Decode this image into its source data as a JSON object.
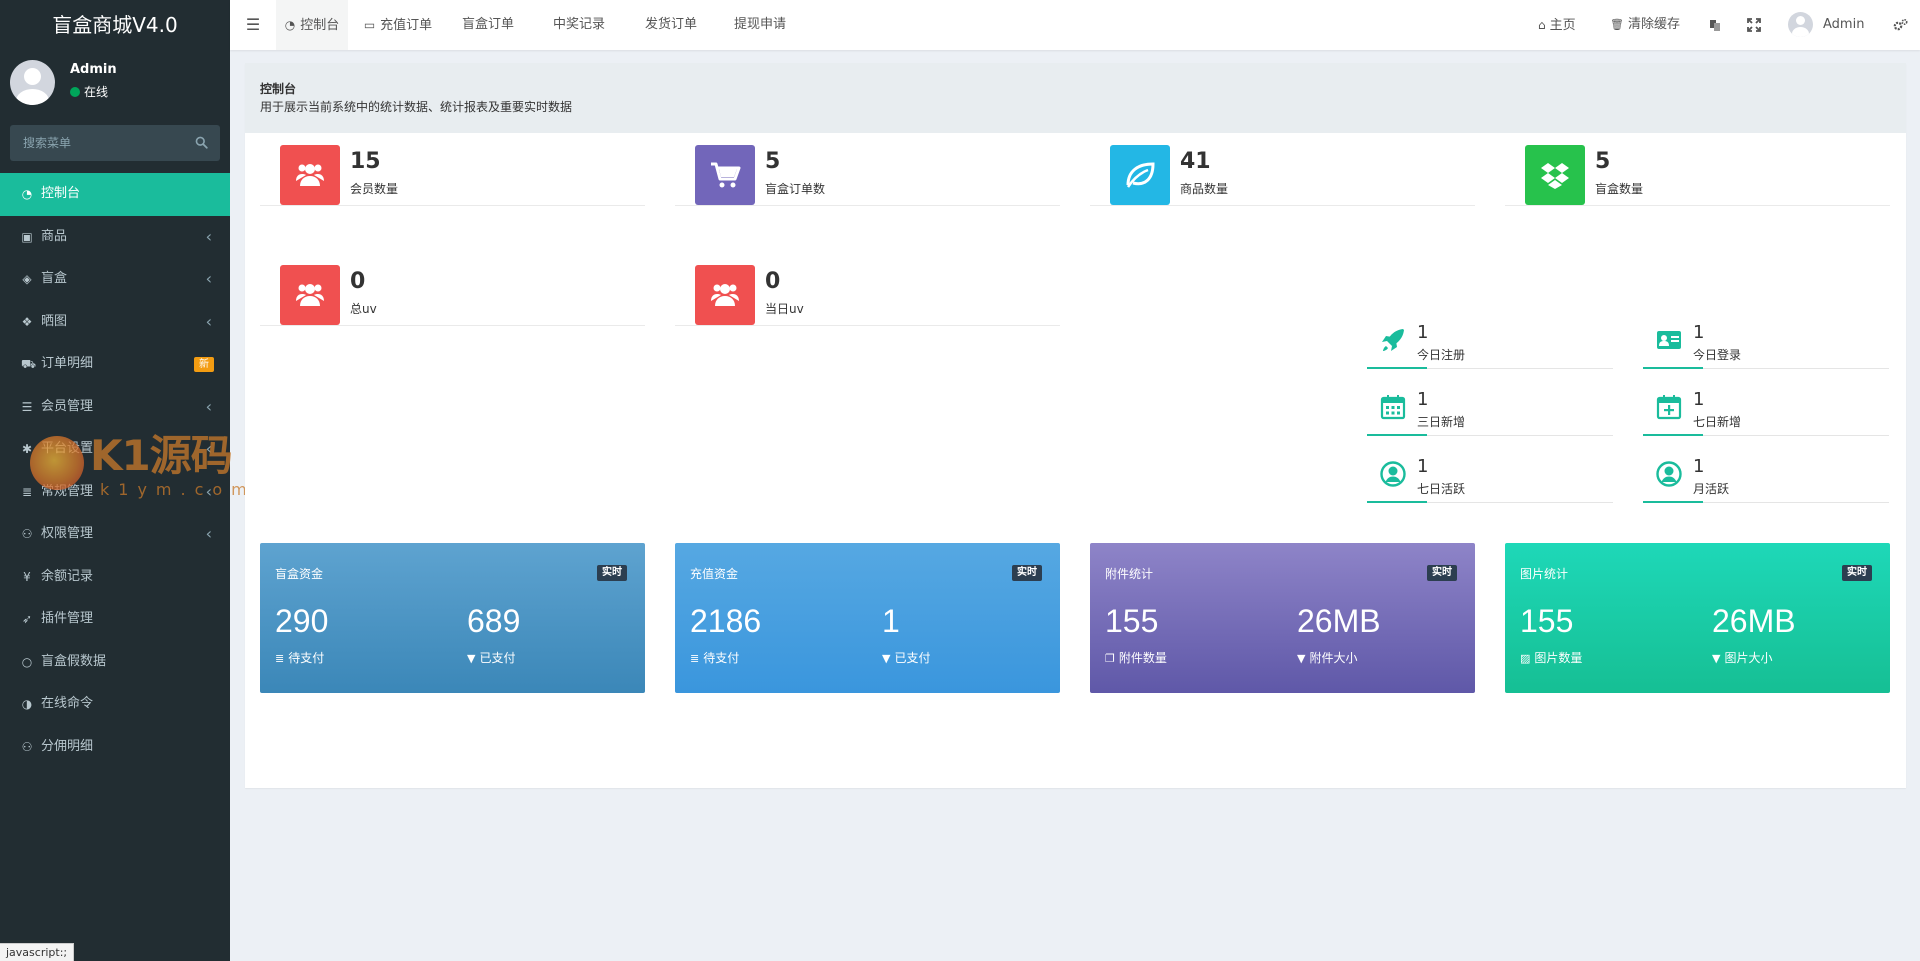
{
  "app": {
    "title": "盲盒商城V4.0"
  },
  "user": {
    "name": "Admin",
    "status": "在线",
    "status_color": "#00a65a"
  },
  "search": {
    "placeholder": "搜索菜单"
  },
  "menu": [
    {
      "label": "控制台",
      "icon": "dashboard-icon",
      "active": true
    },
    {
      "label": "商品",
      "icon": "shopping-bag-icon",
      "chevron": true
    },
    {
      "label": "盲盒",
      "icon": "cube-icon",
      "chevron": true
    },
    {
      "label": "晒图",
      "icon": "dropbox-icon",
      "chevron": true
    },
    {
      "label": "订单明细",
      "icon": "cart-icon",
      "badge": "新"
    },
    {
      "label": "会员管理",
      "icon": "list-icon",
      "chevron": true
    },
    {
      "label": "平台设置",
      "icon": "gear-icon",
      "chevron": true
    },
    {
      "label": "常规管理",
      "icon": "database-icon",
      "chevron": true
    },
    {
      "label": "权限管理",
      "icon": "group-icon",
      "chevron": true
    },
    {
      "label": "余额记录",
      "icon": "yen-icon"
    },
    {
      "label": "插件管理",
      "icon": "rocket-icon"
    },
    {
      "label": "盲盒假数据",
      "icon": "circle-icon"
    },
    {
      "label": "在线命令",
      "icon": "adjust-icon"
    },
    {
      "label": "分佣明细",
      "icon": "group-icon"
    }
  ],
  "watermark": {
    "text": "K1源码",
    "sub": "k1ym.com"
  },
  "status_tip": "javascript:;",
  "tabs": [
    {
      "label": "控制台",
      "icon": "dashboard-icon",
      "active": true
    },
    {
      "label": "充值订单",
      "icon": "battery-icon"
    },
    {
      "label": "盲盒订单"
    },
    {
      "label": "中奖记录"
    },
    {
      "label": "发货订单"
    },
    {
      "label": "提现申请"
    }
  ],
  "topnav": {
    "home": "主页",
    "clear_cache": "清除缓存",
    "user": "Admin"
  },
  "page": {
    "title": "控制台",
    "desc": "用于展示当前系统中的统计数据、统计报表及重要实时数据"
  },
  "stats": [
    {
      "value": "15",
      "label": "会员数量",
      "color": "#f05050",
      "icon": "users-icon"
    },
    {
      "value": "5",
      "label": "盲盒订单数",
      "color": "#7266ba",
      "icon": "cart-icon"
    },
    {
      "value": "41",
      "label": "商品数量",
      "color": "#23b7e5",
      "icon": "leaf-icon"
    },
    {
      "value": "5",
      "label": "盲盒数量",
      "color": "#27c24c",
      "icon": "dropbox-icon"
    },
    {
      "value": "0",
      "label": "总uv",
      "color": "#f05050",
      "icon": "users-icon"
    },
    {
      "value": "0",
      "label": "当日uv",
      "color": "#f05050",
      "icon": "users-icon"
    }
  ],
  "mini_stats": [
    {
      "value": "1",
      "label": "今日注册",
      "icon": "rocket-icon"
    },
    {
      "value": "1",
      "label": "今日登录",
      "icon": "id-card-icon"
    },
    {
      "value": "1",
      "label": "三日新增",
      "icon": "calendar-icon"
    },
    {
      "value": "1",
      "label": "七日新增",
      "icon": "calendar-plus-icon"
    },
    {
      "value": "1",
      "label": "七日活跃",
      "icon": "user-circle-icon"
    },
    {
      "value": "1",
      "label": "月活跃",
      "icon": "user-circle-icon"
    }
  ],
  "cards": [
    {
      "title": "盲盒资金",
      "badge": "实时",
      "v1": "290",
      "l1": "待支付",
      "i1": "database-icon",
      "v2": "689",
      "l2": "已支付",
      "i2": "filter-icon",
      "bg": "linear-gradient(180deg,#5ea3d0,#3b87b8)"
    },
    {
      "title": "充值资金",
      "badge": "实时",
      "v1": "2186",
      "l1": "待支付",
      "i1": "database-icon",
      "v2": "1",
      "l2": "已支付",
      "i2": "filter-icon",
      "bg": "linear-gradient(180deg,#56a8e2,#3a96dd)"
    },
    {
      "title": "附件统计",
      "badge": "实时",
      "v1": "155",
      "l1": "附件数量",
      "i1": "files-icon",
      "v2": "26MB",
      "l2": "附件大小",
      "i2": "filter-icon",
      "bg": "linear-gradient(180deg,#8e84c8,#5f58a8)"
    },
    {
      "title": "图片统计",
      "badge": "实时",
      "v1": "155",
      "l1": "图片数量",
      "i1": "image-icon",
      "v2": "26MB",
      "l2": "图片大小",
      "i2": "filter-icon",
      "bg": "linear-gradient(180deg,#1ed8b8,#16bf94)"
    }
  ]
}
